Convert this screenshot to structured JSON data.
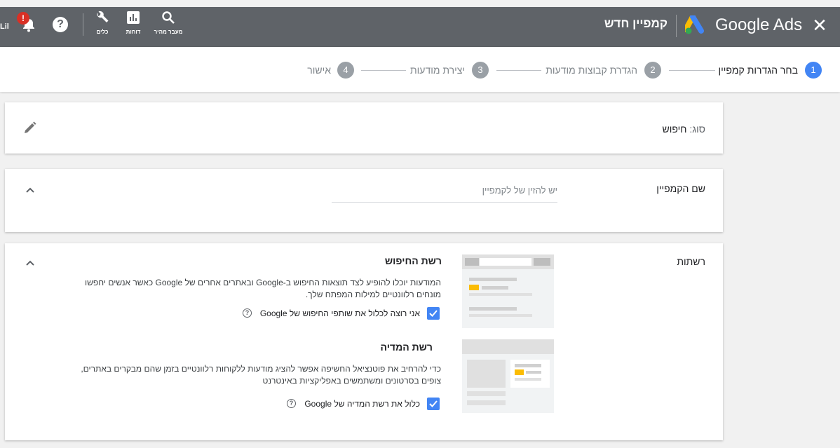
{
  "topbar": {
    "product_name": "Google Ads",
    "page_title": "קמפיין חדש",
    "tools": [
      {
        "label": "מעבר מהיר",
        "icon": "search-icon"
      },
      {
        "label": "דוחות",
        "icon": "reports-icon"
      },
      {
        "label": "כלים",
        "icon": "wrench-icon"
      }
    ],
    "help_symbol": "?",
    "alert_symbol": "!",
    "account_fragment": "Lil"
  },
  "stepper": {
    "steps": [
      {
        "num": "1",
        "label": "בחר הגדרות קמפיין",
        "active": true
      },
      {
        "num": "2",
        "label": "הגדרת קבוצות מודעות",
        "active": false
      },
      {
        "num": "3",
        "label": "יצירת מודעות",
        "active": false
      },
      {
        "num": "4",
        "label": "אישור",
        "active": false
      }
    ]
  },
  "type_card": {
    "label": "סוג:",
    "value": "חיפוש"
  },
  "name_card": {
    "label": "שם הקמפיין",
    "placeholder": "יש להזין של לקמפיין"
  },
  "networks_card": {
    "label": "רשתות",
    "search_network": {
      "title": "רשת החיפוש",
      "description": "המודעות יוכלו להופיע לצד תוצאות החיפוש ב-Google ובאתרים אחרים של Google כאשר אנשים יחפשו מונחים רלוונטיים למילות המפתח שלך.",
      "checkbox_label": "אני רוצה לכלול את שותפי החיפוש של Google",
      "checked": true
    },
    "display_network": {
      "title": "רשת המדיה",
      "description": "כדי להרחיב את פוטנציאל החשיפה אפשר להציג מודעות ללקוחות רלוונטיים בזמן שהם מבקרים באתרים, צופים בסרטונים ומשתמשים באפליקציות באינטרנט",
      "checkbox_label": "כלול את רשת המדיה של Google",
      "checked": true
    }
  },
  "colors": {
    "topbar_bg": "#5f6368",
    "accent_blue": "#4285f4",
    "step_inactive": "#9aa0a6",
    "alert_red": "#d93025",
    "ads_yellow": "#fbbc04",
    "ads_green": "#34a853"
  }
}
